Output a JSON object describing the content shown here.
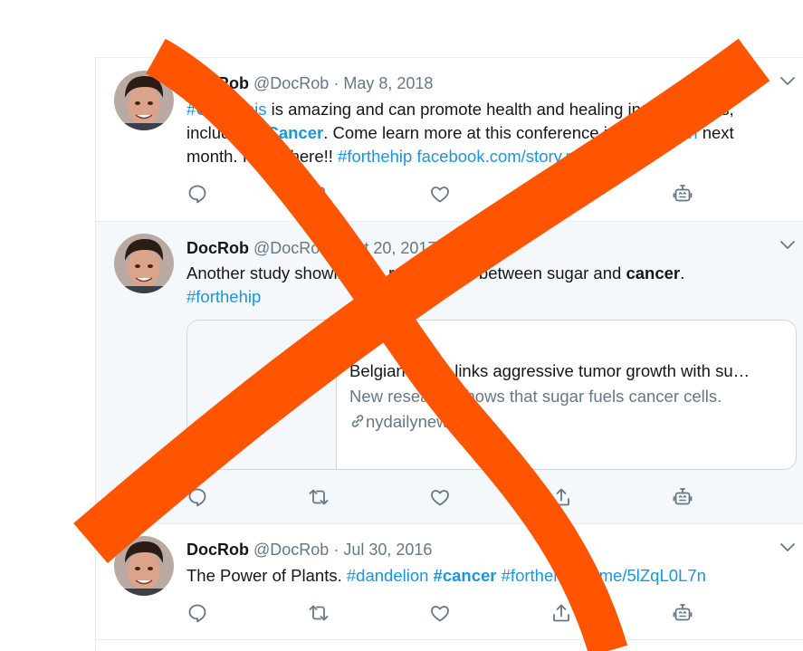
{
  "colors": {
    "link": "#1b95e0",
    "muted": "#657786",
    "text": "#14171a",
    "overlay": "#ff5500",
    "border": "#e6ecf0"
  },
  "tweets": [
    {
      "name": "DocRob",
      "handle": "@DocRob",
      "separator": "·",
      "date": "May 8, 2018",
      "text": {
        "t1": "#Cannabis",
        "t2": " is amazing and can promote health and healing in many ways, including ",
        "t3": "#Cancer",
        "t4": ". Come learn more at this conference in ",
        "t5": "#Michigan",
        "t6": " next month.  I'll be there!!  ",
        "t7": "#forthehip",
        "t8": " ",
        "t9": "facebook.com/story.php?stor…"
      }
    },
    {
      "name": "DocRob",
      "handle": "@DocRob",
      "separator": "·",
      "date": "Oct 20, 2017",
      "text": {
        "t1": "Another study showing the relationship between sugar and ",
        "t2": "cancer",
        "t3": ".",
        "t4": "#forthehip"
      },
      "card": {
        "title": "Belgian study links aggressive tumor growth with su…",
        "description": "New research shows that sugar fuels cancer cells.",
        "domain": "nydailynews.com",
        "thumb_icon": "document-icon"
      }
    },
    {
      "name": "DocRob",
      "handle": "@DocRob",
      "separator": "·",
      "date": "Jul 30, 2016",
      "text": {
        "t1": "The Power of Plants. ",
        "t2": "#dandelion",
        "t3": " ",
        "t4": "#cancer",
        "t5": " ",
        "t6": "#forthehip",
        "t7": " ",
        "t8": "fb.me/5lZqL0L7n"
      }
    }
  ],
  "action_icons": [
    "reply-icon",
    "retweet-icon",
    "like-icon",
    "share-icon",
    "bot-icon"
  ]
}
